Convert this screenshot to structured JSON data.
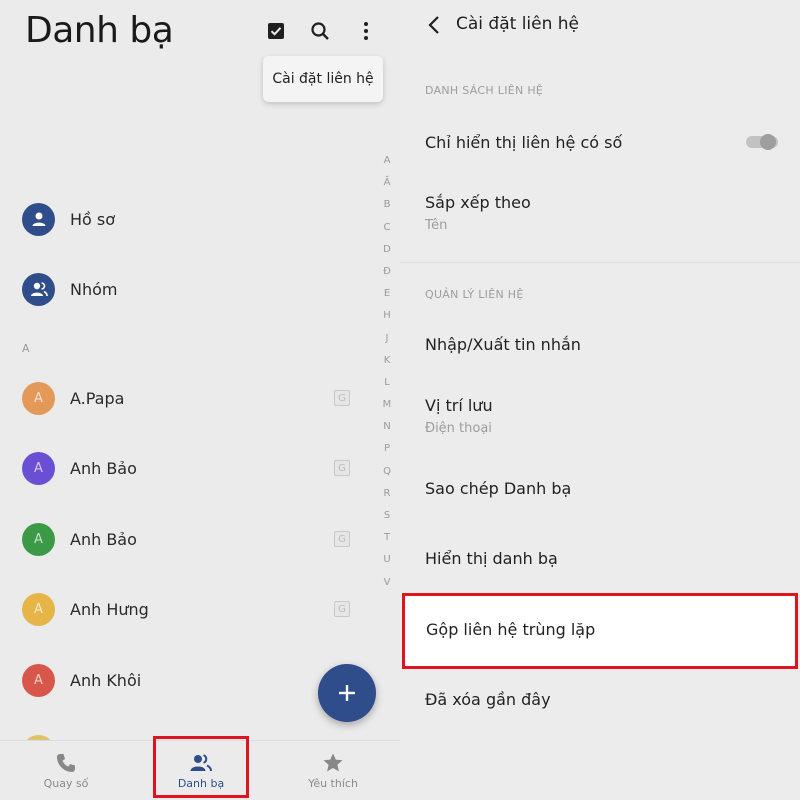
{
  "left": {
    "title": "Danh bạ",
    "popup_label": "Cài đặt liên hệ",
    "icons": {
      "select": "checkbox-icon",
      "search": "search-icon",
      "more": "more-vertical-icon"
    },
    "profile_rows": [
      {
        "label": "Hồ sơ",
        "icon": "person-icon",
        "color": "#2f4d8a"
      },
      {
        "label": "Nhóm",
        "icon": "group-icon",
        "color": "#2f4d8a"
      }
    ],
    "section_letter": "A",
    "contacts": [
      {
        "initial": "A",
        "name": "A.Papa",
        "color": "#e39a59",
        "badge": "G"
      },
      {
        "initial": "A",
        "name": "Anh Bảo",
        "color": "#6a4fd4",
        "badge": "G"
      },
      {
        "initial": "A",
        "name": "Anh Bảo",
        "color": "#3c9a46",
        "badge": "G"
      },
      {
        "initial": "A",
        "name": "Anh Hưng",
        "color": "#e5b547",
        "badge": "G"
      },
      {
        "initial": "A",
        "name": "Anh Khôi",
        "color": "#d8574b",
        "badge": "G"
      }
    ],
    "alphabet": [
      "A",
      "Ă",
      "B",
      "C",
      "D",
      "Đ",
      "E",
      "H",
      "J",
      "K",
      "L",
      "M",
      "N",
      "P",
      "Q",
      "R",
      "S",
      "T",
      "U",
      "V"
    ],
    "bottom_nav": [
      {
        "label": "Quay số",
        "icon": "phone-icon",
        "active": false
      },
      {
        "label": "Danh bạ",
        "icon": "contacts-icon",
        "active": true
      },
      {
        "label": "Yêu thích",
        "icon": "star-icon",
        "active": false
      }
    ]
  },
  "right": {
    "header_title": "Cài đặt liên hệ",
    "section1": "DANH SÁCH LIÊN HỆ",
    "section2": "QUẢN LÝ LIÊN HỆ",
    "settings": {
      "only_with_number": {
        "title": "Chỉ hiển thị liên hệ có số",
        "toggle": false
      },
      "sort_by": {
        "title": "Sắp xếp theo",
        "value": "Tên"
      },
      "import_export": {
        "title": "Nhập/Xuất tin nhắn"
      },
      "storage": {
        "title": "Vị trí lưu",
        "value": "Điện thoại"
      },
      "copy": {
        "title": "Sao chép Danh bạ"
      },
      "display": {
        "title": "Hiển thị danh bạ"
      },
      "merge": {
        "title": "Gộp liên hệ trùng lặp"
      },
      "deleted": {
        "title": "Đã xóa gần đây"
      }
    }
  },
  "colors": {
    "accent": "#2f4d8a",
    "highlight": "#e0141e"
  }
}
